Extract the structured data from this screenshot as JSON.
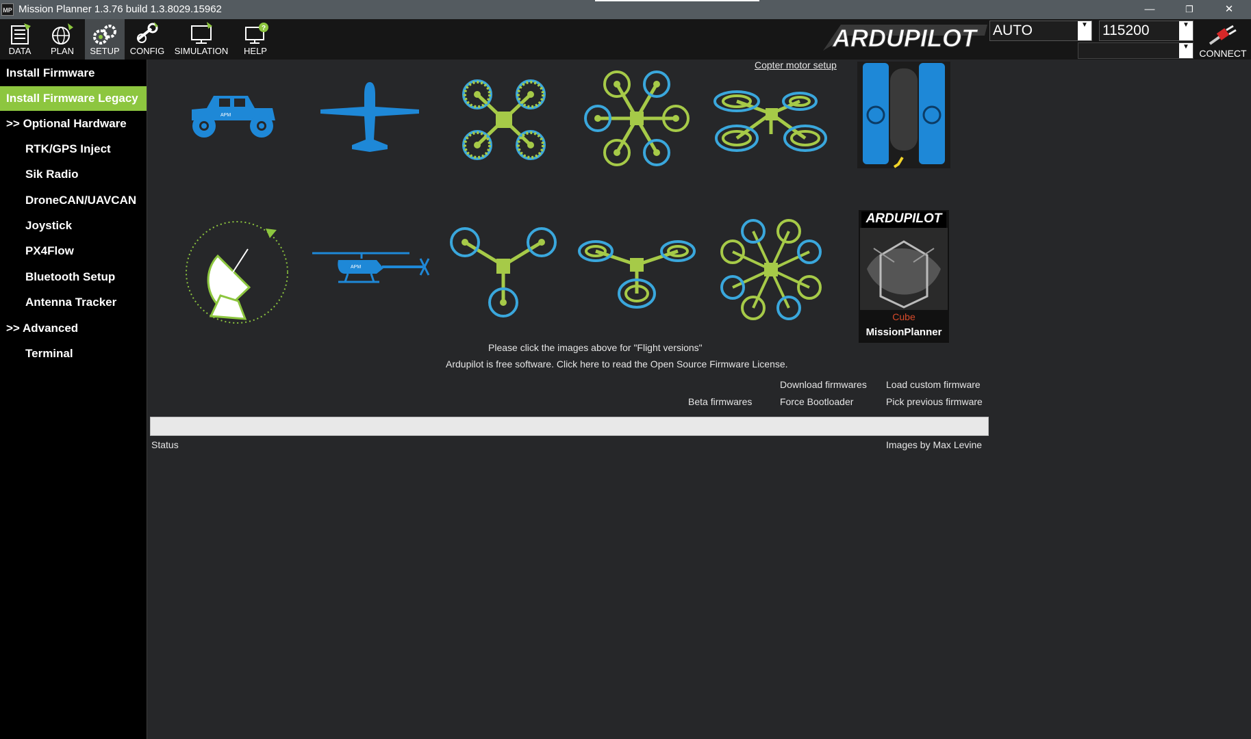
{
  "window": {
    "title": "Mission Planner 1.3.76 build 1.3.8029.15962",
    "icon_text": "MP",
    "minimize": "—",
    "restore": "❐",
    "close": "✕"
  },
  "toolbar": {
    "buttons": [
      {
        "label": "DATA",
        "icon": "data-icon"
      },
      {
        "label": "PLAN",
        "icon": "plan-icon"
      },
      {
        "label": "SETUP",
        "icon": "setup-icon"
      },
      {
        "label": "CONFIG",
        "icon": "config-icon"
      },
      {
        "label": "SIMULATION",
        "icon": "simulation-icon"
      },
      {
        "label": "HELP",
        "icon": "help-icon"
      }
    ],
    "active": "SETUP",
    "logo_text": "ARDUPILOT",
    "mode_value": "AUTO",
    "baud_value": "115200",
    "connect_label": "CONNECT"
  },
  "sidebar": {
    "items": [
      {
        "label": "Install Firmware"
      },
      {
        "label": "Install Firmware Legacy"
      },
      {
        "label": ">> Optional Hardware"
      },
      {
        "label": "RTK/GPS Inject"
      },
      {
        "label": "Sik Radio"
      },
      {
        "label": "DroneCAN/UAVCAN"
      },
      {
        "label": "Joystick"
      },
      {
        "label": "PX4Flow"
      },
      {
        "label": "Bluetooth Setup"
      },
      {
        "label": "Antenna Tracker"
      },
      {
        "label": ">> Advanced"
      },
      {
        "label": "Terminal"
      }
    ],
    "active_index": 1
  },
  "main": {
    "copter_motor_setup": "Copter motor setup",
    "vehicles": [
      {
        "name": "rover"
      },
      {
        "name": "plane"
      },
      {
        "name": "quad-x"
      },
      {
        "name": "hexa-x"
      },
      {
        "name": "y6"
      },
      {
        "name": "sub"
      },
      {
        "name": "antenna-tracker"
      },
      {
        "name": "helicopter"
      },
      {
        "name": "tri"
      },
      {
        "name": "y6b"
      },
      {
        "name": "octa"
      },
      {
        "name": "cube"
      }
    ],
    "cube_logo_text": "ARDUPILOT",
    "cube_label": "Cube",
    "cube_mp_text": "MissionPlanner",
    "info_line1": "Please click the images above for \"Flight versions\"",
    "info_line2": "Ardupilot is free software. Click here to read the Open Source Firmware License.",
    "download_firmwares": "Download firmwares",
    "load_custom_firmware": "Load custom firmware",
    "beta_firmwares": "Beta firmwares",
    "force_bootloader": "Force Bootloader",
    "pick_previous_firmware": "Pick previous firmware",
    "progress": 0,
    "status_label": "Status",
    "images_credit": "Images by Max Levine"
  },
  "colors": {
    "accent_green": "#8dc63f",
    "blue": "#1e88d7",
    "cyan": "#3aa7dc",
    "lime": "#a6ca48"
  }
}
